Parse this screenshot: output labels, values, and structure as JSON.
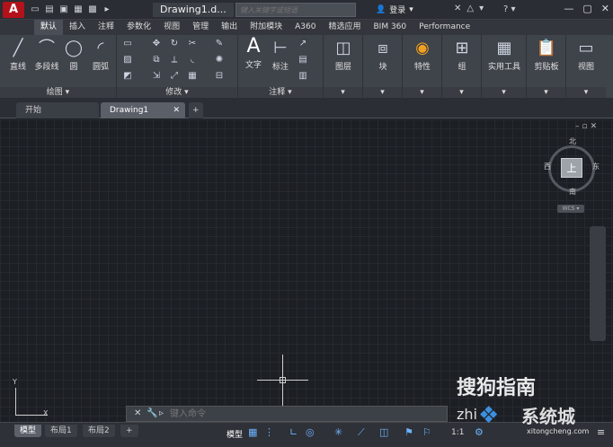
{
  "app": {
    "title": "Drawing1.d...",
    "search_placeholder": "键入关键字或短语",
    "login": "登录",
    "help": "?"
  },
  "qat_icons": [
    "new",
    "open",
    "save",
    "saveas",
    "print",
    "more"
  ],
  "tabs": [
    "默认",
    "插入",
    "注释",
    "参数化",
    "视图",
    "管理",
    "输出",
    "附加模块",
    "A360",
    "精选应用",
    "BIM 360",
    "Performance"
  ],
  "ribbon": {
    "draw": {
      "title": "绘图",
      "line": "直线",
      "polyline": "多段线",
      "circle": "圆",
      "arc": "圆弧"
    },
    "modify": {
      "title": "修改"
    },
    "annotate": {
      "title": "注释",
      "text": "文字",
      "dimension": "标注"
    },
    "layers": "图层",
    "block": "块",
    "properties": "特性",
    "group": "组",
    "utilities": "实用工具",
    "clipboard": "剪贴板",
    "view": "视图"
  },
  "doc_tabs": {
    "start": "开始",
    "drawing": "Drawing1"
  },
  "viewcube": {
    "north": "北",
    "south": "南",
    "east": "东",
    "west": "西",
    "top": "上",
    "wcs": "WCS"
  },
  "ucs": {
    "x": "X",
    "y": "Y"
  },
  "command": {
    "placeholder": "键入命令"
  },
  "layout_tabs": [
    "模型",
    "布局1",
    "布局2"
  ],
  "status": {
    "model": "模型",
    "scale": "1:1"
  },
  "watermark": {
    "line1": "搜狗指南",
    "line2": "zhi",
    "line3": "系统城",
    "url": "xitongcheng.com"
  }
}
